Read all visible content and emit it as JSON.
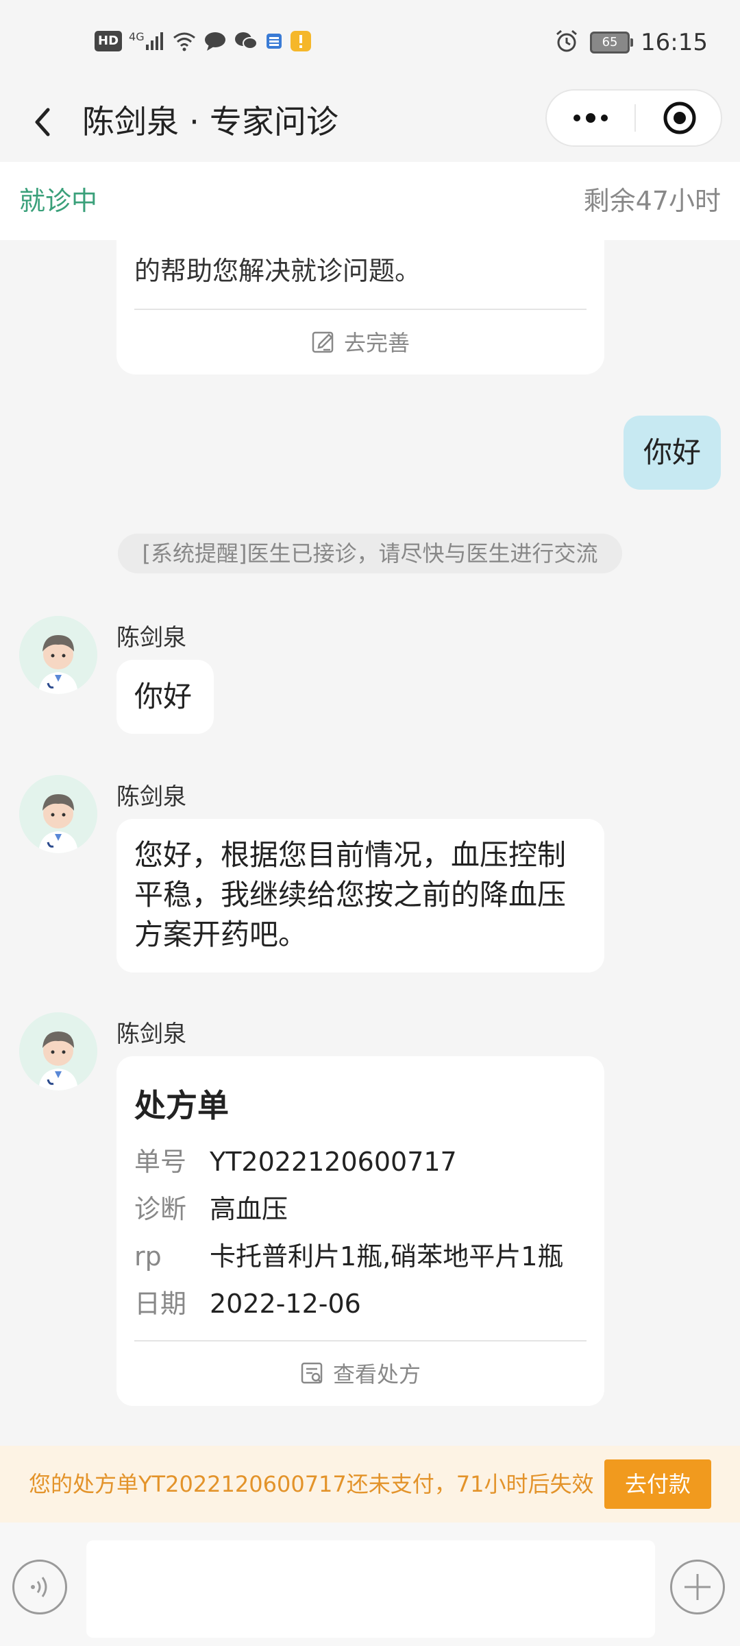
{
  "status_bar": {
    "hd": "HD",
    "network": "4G",
    "battery": "65",
    "time": "16:15",
    "icons": [
      "hd-icon",
      "signal-icon",
      "wifi-icon",
      "chat-bubble-icon",
      "wechat-icon",
      "app-icon",
      "notification-icon",
      "alarm-icon",
      "battery-icon"
    ]
  },
  "header": {
    "title": "陈剑泉 · 专家问诊",
    "back_icon": "chevron-left-icon",
    "more_icon": "more-dots-icon",
    "target_icon": "target-icon"
  },
  "info_bar": {
    "status": "就诊中",
    "remaining": "剩余47小时"
  },
  "intro_card": {
    "text": "的帮助您解决就诊问题。",
    "action": "去完善"
  },
  "self_message": {
    "text": "你好"
  },
  "system_notice": {
    "text": "[系统提醒]医生已接诊，请尽快与医生进行交流"
  },
  "messages": [
    {
      "sender": "陈剑泉",
      "text": "你好"
    },
    {
      "sender": "陈剑泉",
      "text": "您好，根据您目前情况，血压控制平稳，我继续给您按之前的降血压方案开药吧。"
    },
    {
      "sender": "陈剑泉",
      "prescription": {
        "title": "处方单",
        "rows": [
          {
            "key": "单号",
            "value": "YT2022120600717"
          },
          {
            "key": "诊断",
            "value": "高血压"
          },
          {
            "key": "rp",
            "value": "卡托普利片1瓶,硝苯地平片1瓶"
          },
          {
            "key": "日期",
            "value": "2022-12-06"
          }
        ],
        "action": "查看处方"
      }
    }
  ],
  "payment_notice": {
    "text": "您的处方单YT2022120600717还未支付，71小时后失效",
    "button": "去付款",
    "accent": "#f19a1e"
  },
  "input_bar": {
    "voice_icon": "voice-icon",
    "plus_icon": "plus-icon",
    "value": ""
  },
  "colors": {
    "primary_green": "#3aa07a",
    "self_bubble": "#c7e9f2",
    "notice_bg": "#fdf3e4",
    "notice_text": "#e3932a"
  }
}
